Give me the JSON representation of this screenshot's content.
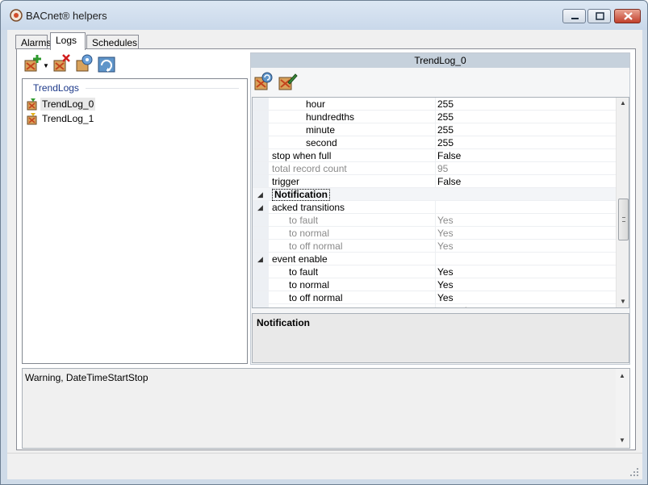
{
  "window": {
    "title": "BACnet® helpers"
  },
  "tabs": [
    {
      "label": "Alarms"
    },
    {
      "label": "Logs"
    },
    {
      "label": "Schedules"
    }
  ],
  "left": {
    "group_header": "TrendLogs",
    "items": [
      {
        "label": "TrendLog_0",
        "selected": true
      },
      {
        "label": "TrendLog_1",
        "selected": false
      }
    ]
  },
  "right": {
    "title": "TrendLog_0",
    "rows": [
      {
        "expander": "",
        "name": "hour",
        "value": "255",
        "indent": 3,
        "muted": false,
        "category": false
      },
      {
        "expander": "",
        "name": "hundredths",
        "value": "255",
        "indent": 3,
        "muted": false,
        "category": false
      },
      {
        "expander": "",
        "name": "minute",
        "value": "255",
        "indent": 3,
        "muted": false,
        "category": false
      },
      {
        "expander": "",
        "name": "second",
        "value": "255",
        "indent": 3,
        "muted": false,
        "category": false
      },
      {
        "expander": "",
        "name": "stop when full",
        "value": "False",
        "indent": 1,
        "muted": false,
        "category": false
      },
      {
        "expander": "",
        "name": "total record count",
        "value": "95",
        "indent": 1,
        "muted": true,
        "category": false
      },
      {
        "expander": "",
        "name": "trigger",
        "value": "False",
        "indent": 1,
        "muted": false,
        "category": false
      },
      {
        "expander": "◢",
        "name": "Notification",
        "value": "",
        "indent": 1,
        "muted": false,
        "category": true
      },
      {
        "expander": "◢",
        "name": "acked transitions",
        "value": "",
        "indent": 1,
        "muted": false,
        "category": false
      },
      {
        "expander": "",
        "name": "to fault",
        "value": "Yes",
        "indent": 2,
        "muted": true,
        "category": false
      },
      {
        "expander": "",
        "name": "to normal",
        "value": "Yes",
        "indent": 2,
        "muted": true,
        "category": false
      },
      {
        "expander": "",
        "name": "to off normal",
        "value": "Yes",
        "indent": 2,
        "muted": true,
        "category": false
      },
      {
        "expander": "◢",
        "name": "event enable",
        "value": "",
        "indent": 1,
        "muted": false,
        "category": false
      },
      {
        "expander": "",
        "name": "to fault",
        "value": "Yes",
        "indent": 2,
        "muted": false,
        "category": false
      },
      {
        "expander": "",
        "name": "to normal",
        "value": "Yes",
        "indent": 2,
        "muted": false,
        "category": false
      },
      {
        "expander": "",
        "name": "to off normal",
        "value": "Yes",
        "indent": 2,
        "muted": false,
        "category": false
      },
      {
        "expander": "",
        "name": "event state",
        "value": "normal",
        "indent": 1,
        "muted": true,
        "category": false
      }
    ],
    "description_title": "Notification",
    "scroll_position": 0.62
  },
  "log": {
    "text": "Warning, DateTimeStartStop"
  },
  "icons": {
    "add": "add-trendlog-icon",
    "remove": "delete-trendlog-icon",
    "settings": "configure-icon",
    "refresh": "refresh-icon",
    "read": "read-properties-icon",
    "write": "write-properties-icon"
  }
}
